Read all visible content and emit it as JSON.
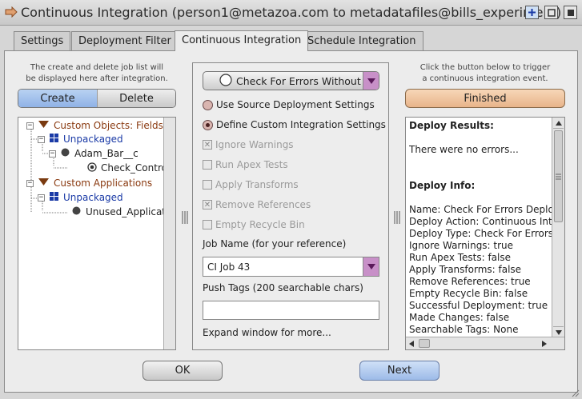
{
  "window": {
    "title": "Continuous Integration (person1@metazoa.com to metadatafiles@bills_experiment)"
  },
  "tabs": [
    {
      "label": "Settings"
    },
    {
      "label": "Deployment Filter"
    },
    {
      "label": "Continuous Integration"
    },
    {
      "label": "Schedule Integration"
    }
  ],
  "left": {
    "note_line1": "The create and delete job list will",
    "note_line2": "be displayed here after integration.",
    "create_label": "Create",
    "delete_label": "Delete",
    "tree": [
      {
        "label": "Custom Objects: Fields"
      },
      {
        "label": "Unpackaged"
      },
      {
        "label": "Adam_Bar__c"
      },
      {
        "label": "Check_Contro"
      },
      {
        "label": "Custom Applications"
      },
      {
        "label": "Unpackaged"
      },
      {
        "label": "Unused_Applicat"
      }
    ]
  },
  "middle": {
    "mode_combo": "Check For Errors Without M",
    "use_source": "Use Source Deployment Settings",
    "define_custom": "Define Custom Integration Settings",
    "ignore_warnings": "Ignore Warnings",
    "run_apex": "Run Apex Tests",
    "apply_transforms": "Apply Transforms",
    "remove_references": "Remove References",
    "empty_recycle": "Empty Recycle Bin",
    "job_name_label": "Job Name (for your reference)",
    "job_name_value": "CI Job 43",
    "push_tags_label": "Push Tags (200 searchable chars)",
    "push_tags_value": "",
    "expand_note": "Expand window for more..."
  },
  "right": {
    "note_line1": "Click the button below to trigger",
    "note_line2": "a continuous integration event.",
    "finished_label": "Finished",
    "results": [
      "Deploy Results:",
      "",
      "There were no errors...",
      "",
      "",
      "Deploy Info:",
      "",
      "Name: Check For Errors Deploy",
      "Deploy Action: Continuous Integ",
      "Deploy Type: Check For Errors",
      "Ignore Warnings: true",
      "Run Apex Tests: false",
      "Apply Transforms: false",
      "Remove References: true",
      "Empty Recycle Bin: false",
      "Successful Deployment: true",
      "Made Changes: false",
      "Searchable Tags: None"
    ]
  },
  "footer": {
    "ok_label": "OK",
    "next_label": "Next"
  },
  "icons": {
    "app": "arrow-right-icon",
    "add": "plus-icon",
    "maximize": "square-icon",
    "close": "close-icon"
  }
}
